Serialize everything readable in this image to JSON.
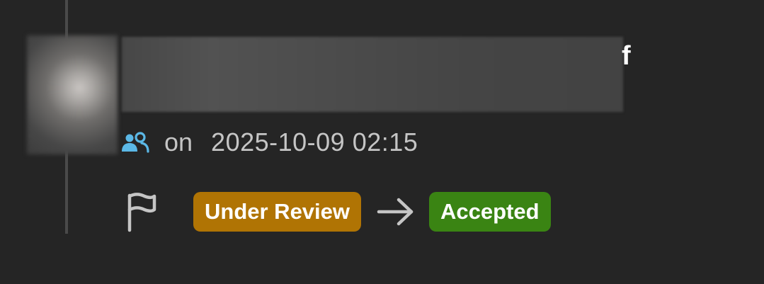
{
  "activity": {
    "title_text": "",
    "title_tail": "f",
    "timestamp_prefix": "on",
    "timestamp": "2025-10-09 02:15",
    "actor_icon": "users-group-icon"
  },
  "status_change": {
    "icon": "flag-icon",
    "from_label": "Under Review",
    "to_label": "Accepted",
    "from_color": "#b07404",
    "to_color": "#3a8413",
    "arrow_icon": "arrow-right-icon"
  },
  "colors": {
    "background": "#252525",
    "timeline": "#4a4a4a",
    "meta_text": "#c5c5c5",
    "group_icon": "#5bb8e6"
  }
}
